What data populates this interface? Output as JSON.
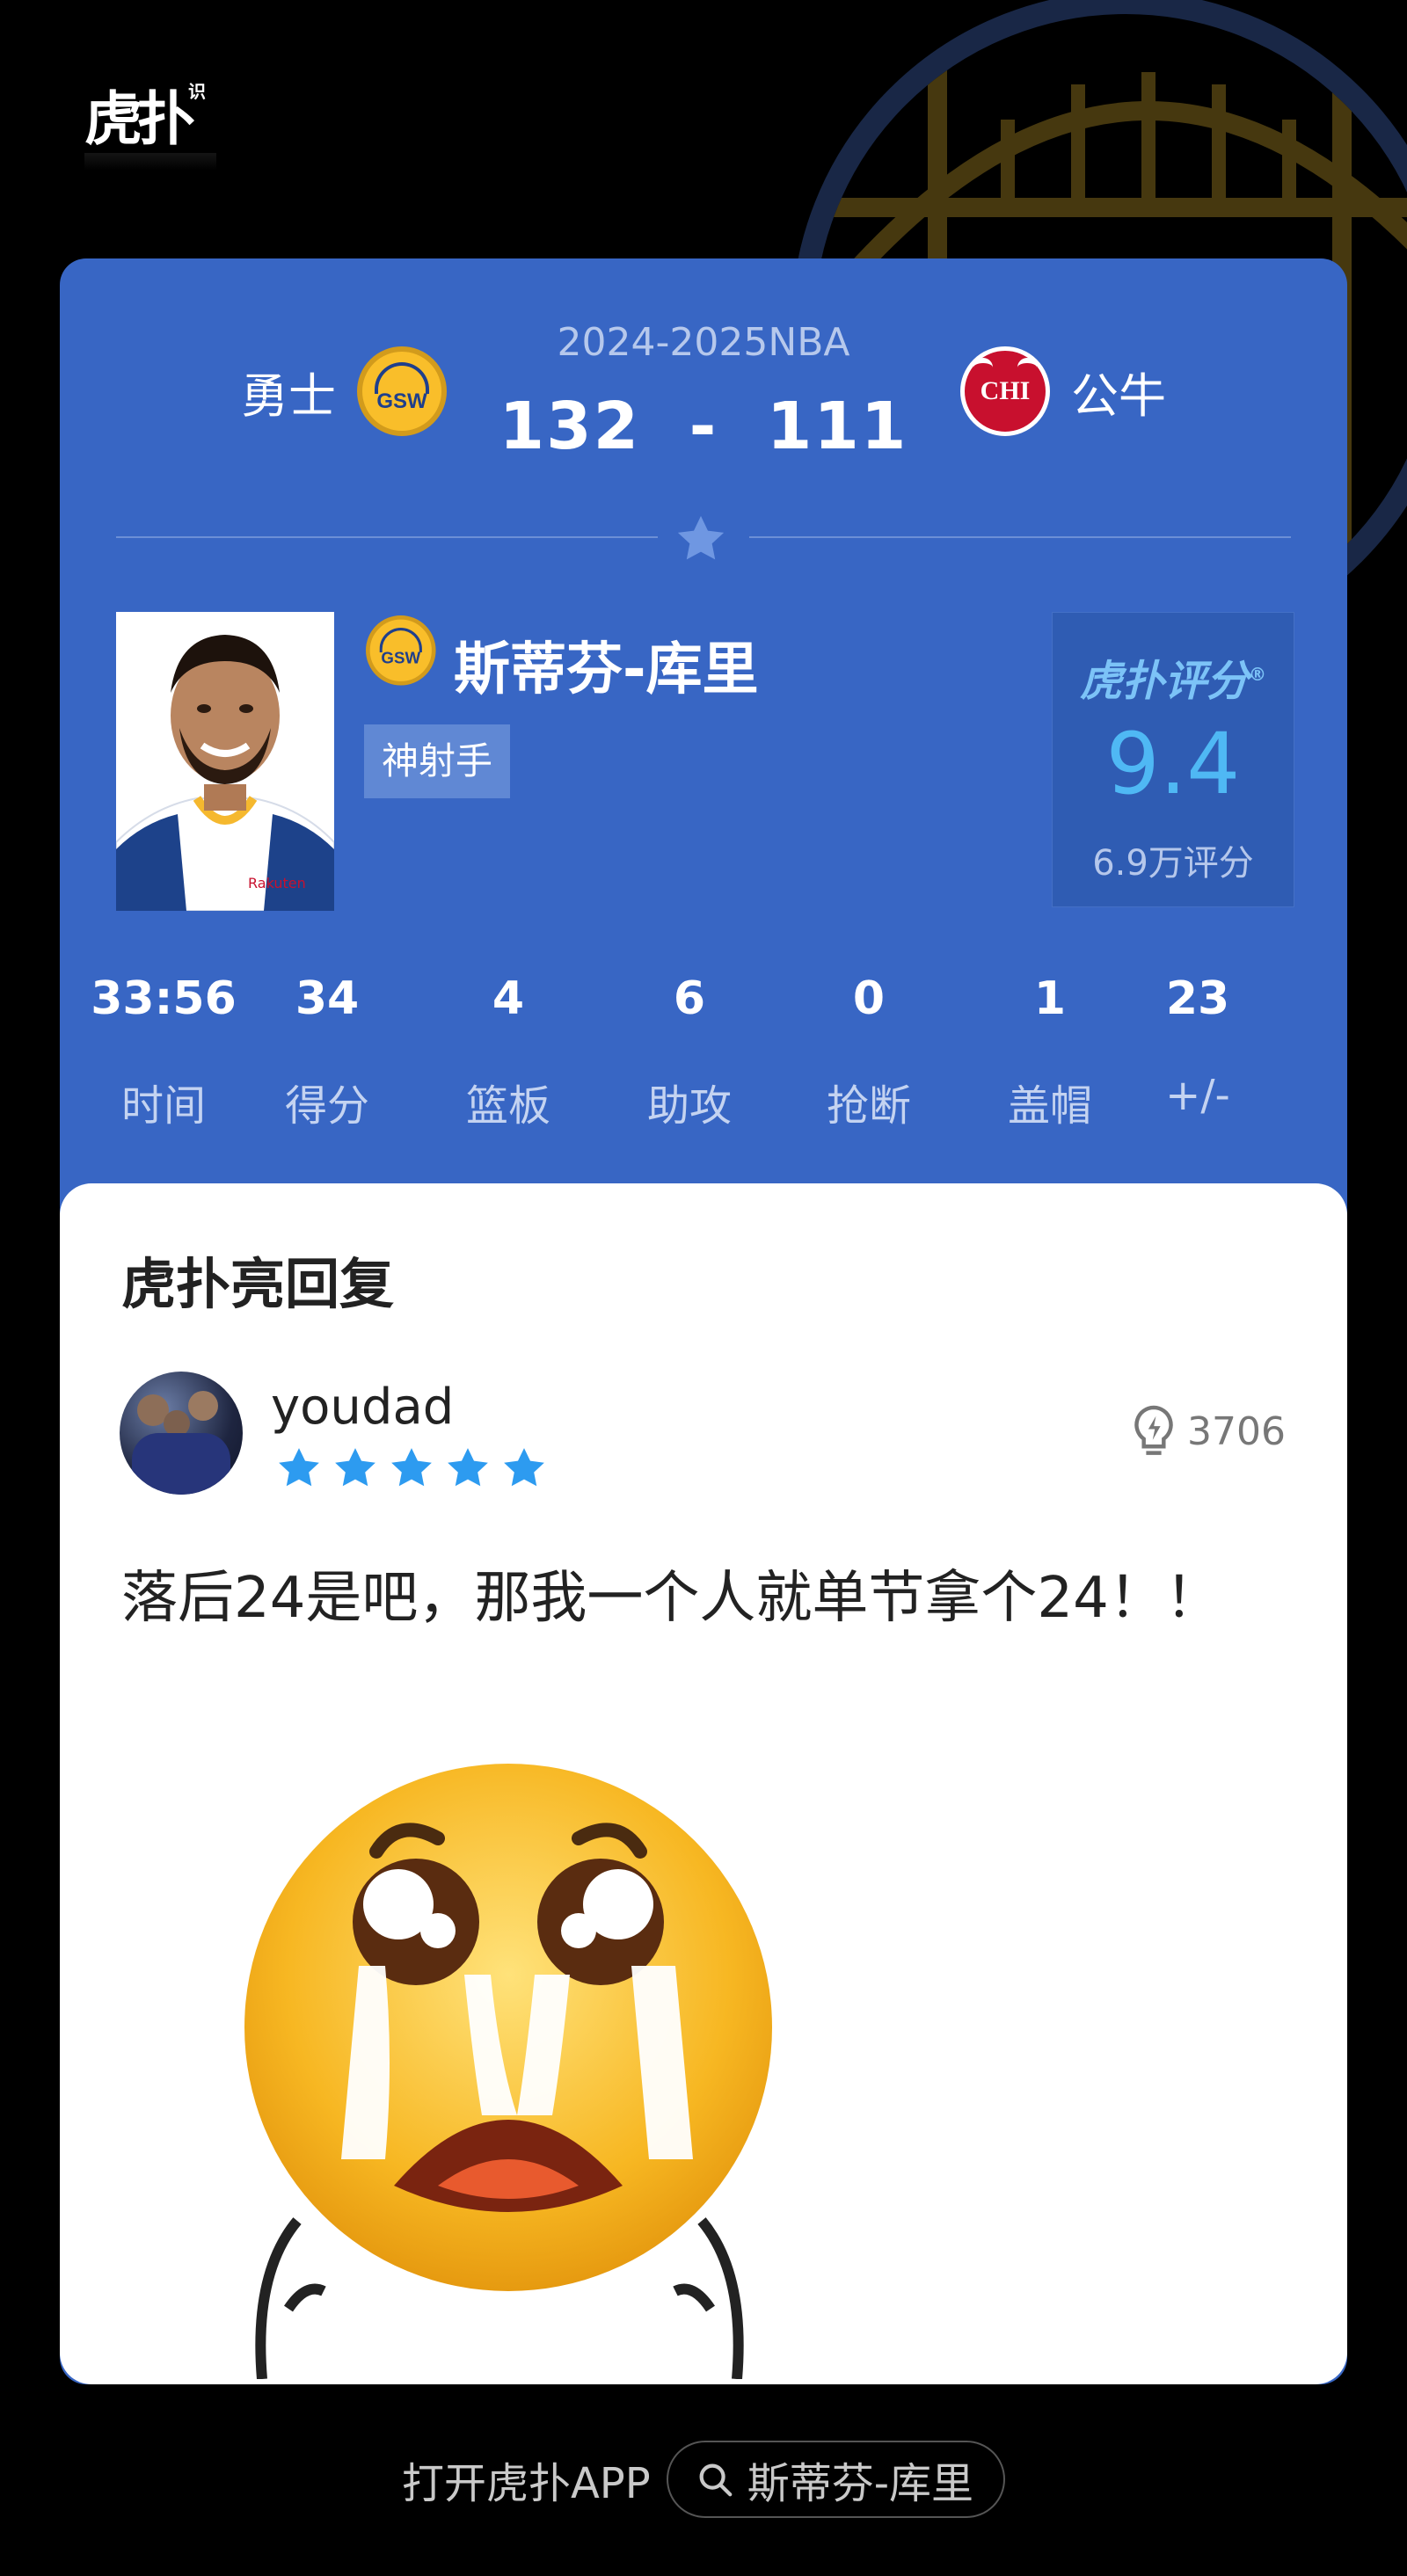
{
  "brand": {
    "name": "虎扑",
    "sub": "识"
  },
  "game": {
    "season": "2024-2025NBA",
    "home": {
      "name": "勇士",
      "abbr": "GSW"
    },
    "away": {
      "name": "公牛",
      "abbr": "CHI"
    },
    "score": "132  -  111"
  },
  "player": {
    "name": "斯蒂芬-库里",
    "tag": "神射手",
    "team_abbr": "GSW"
  },
  "rating": {
    "brand": "虎扑评分",
    "registered": "®",
    "score": "9.4",
    "count": "6.9万评分"
  },
  "stats": [
    {
      "value": "33:56",
      "label": "时间"
    },
    {
      "value": "34",
      "label": "得分"
    },
    {
      "value": "4",
      "label": "篮板"
    },
    {
      "value": "6",
      "label": "助攻"
    },
    {
      "value": "0",
      "label": "抢断"
    },
    {
      "value": "1",
      "label": "盖帽"
    },
    {
      "value": "23",
      "label": "+/-"
    }
  ],
  "reply": {
    "section_title": "虎扑亮回复",
    "username": "youdad",
    "stars": 5,
    "light_count": "3706",
    "text": "落后24是吧，那我一个人就单节拿个24！！"
  },
  "footer": {
    "open_app": "打开虎扑APP",
    "search_text": "斯蒂芬-库里"
  },
  "colors": {
    "card_blue": "#3866c4",
    "rating_blue": "#4fb8f4",
    "star_blue": "#2d9bf0"
  },
  "icons": [
    "star-icon",
    "lightbulb-icon",
    "search-icon"
  ]
}
